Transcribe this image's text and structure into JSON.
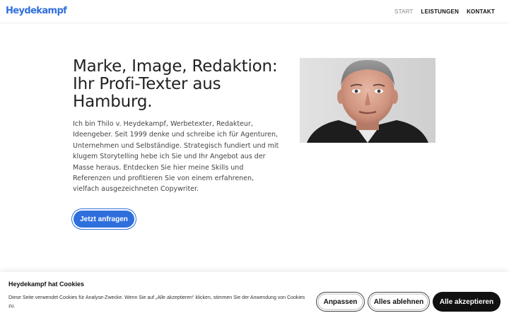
{
  "header": {
    "logo": "Heydekampf",
    "nav": [
      {
        "label": "START",
        "active": true
      },
      {
        "label": "LEISTUNGEN",
        "active": false
      },
      {
        "label": "KONTAKT",
        "active": false
      }
    ]
  },
  "hero": {
    "headline": "Marke, Image, Redaktion: Ihr Profi-Texter aus Hamburg.",
    "intro": "Ich bin Thilo v. Heydekampf, Werbetexter, Redakteur, Ideengeber. Seit 1999 denke und schreibe ich für Agenturen, Unternehmen und Selbständige. Strategisch fundiert und mit klugem Storytelling hebe ich Sie und Ihr Angebot aus der Masse heraus. Entdecken Sie hier meine Skills und Referenzen und profitieren Sie von einem erfahrenen, vielfach ausgezeichneten Copywriter.",
    "cta_label": "Jetzt anfragen"
  },
  "cookie": {
    "title": "Heydekampf hat Cookies",
    "text": "Diese Seite verwendet Cookies für Analyse-Zwecke. Wenn Sie auf „Alle akzeptieren“ klicken, stimmen Sie der Anwendung von Cookies zu.",
    "customize_label": "Anpassen",
    "reject_label": "Alles ablehnen",
    "accept_label": "Alle akzeptieren"
  },
  "colors": {
    "accent": "#2f6fdc",
    "text": "#222222",
    "accept_bg": "#111111"
  }
}
